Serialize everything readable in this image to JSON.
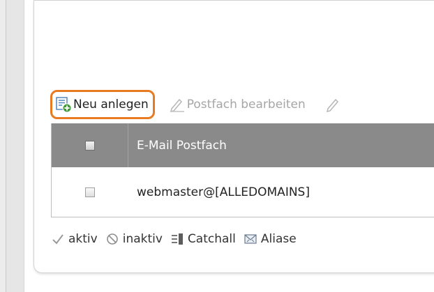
{
  "toolbar": {
    "new_label": "Neu anlegen",
    "edit_label": "Postfach bearbeiten"
  },
  "grid": {
    "column_header": "E-Mail Postfach",
    "rows": [
      {
        "mailbox": "webmaster@[ALLEDOMAINS]"
      }
    ]
  },
  "legend": {
    "active": "aktiv",
    "inactive": "inaktiv",
    "catchall": "Catchall",
    "aliases": "Aliase"
  },
  "colors": {
    "accent": "#e87a22",
    "header_bg": "#8a8a8a",
    "disabled_text": "#a6a6a6"
  },
  "icons": {
    "new": "new-entry-icon",
    "edit": "pencil-icon",
    "active": "checkmark-icon",
    "inactive": "no-entry-icon",
    "catchall": "catchall-icon",
    "aliases": "envelope-arrows-icon"
  }
}
